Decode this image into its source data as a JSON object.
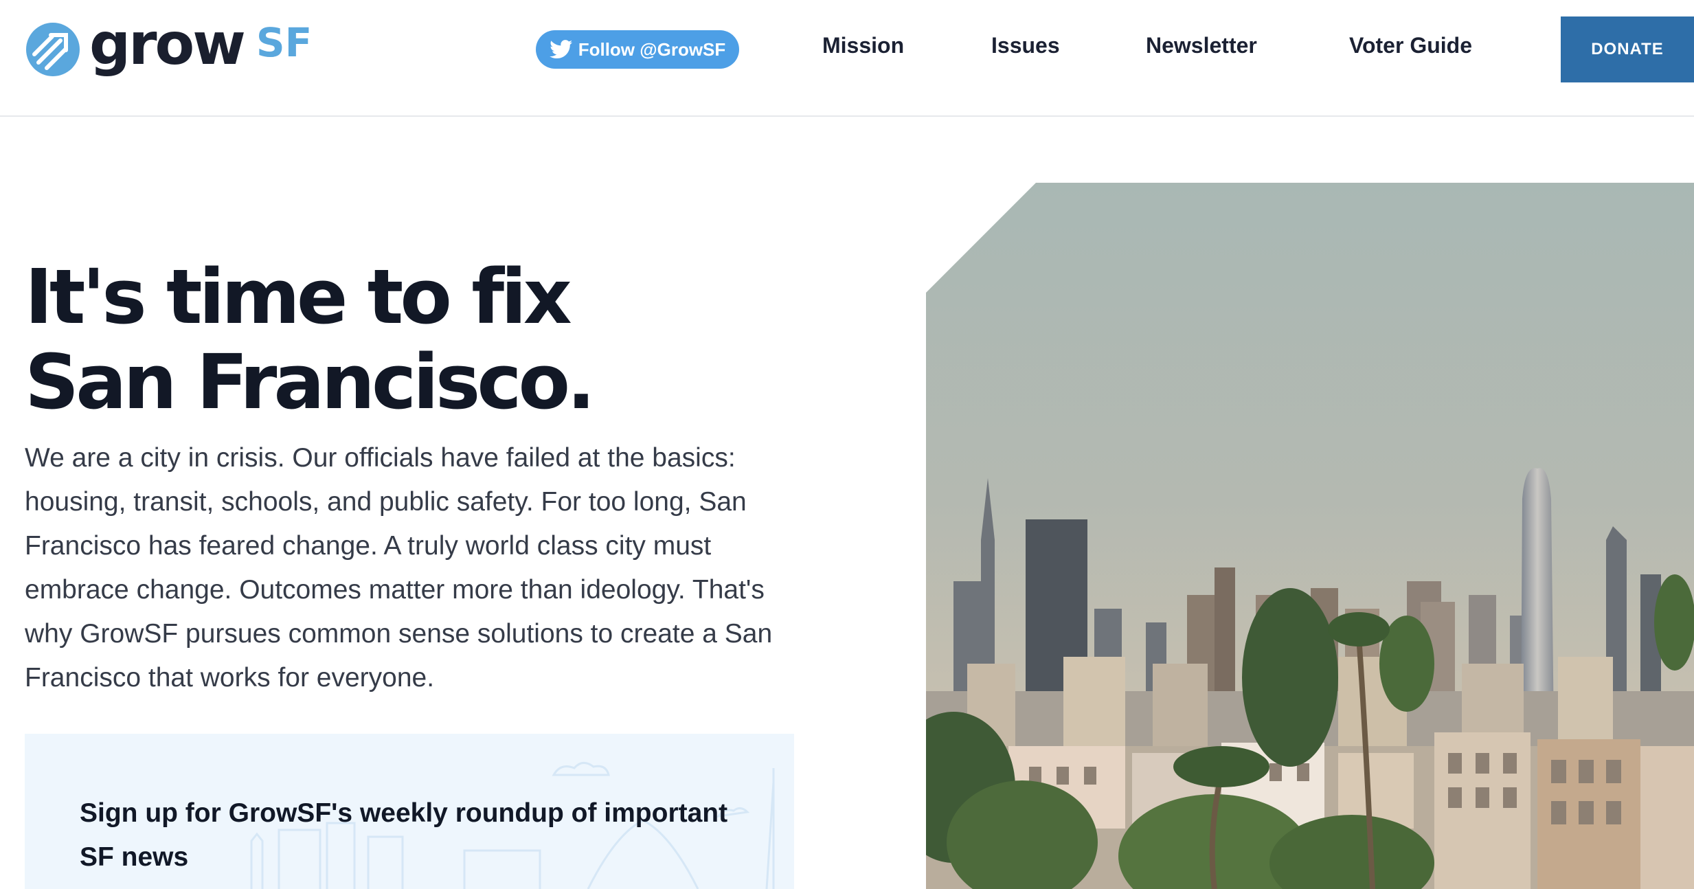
{
  "brand": {
    "logo_text": "grow",
    "logo_suffix": "SF",
    "logo_icon": "arrows-circle-icon",
    "accent_color": "#5aa7dd",
    "dark_color": "#1a1f2e"
  },
  "header": {
    "twitter_label": "Follow @GrowSF",
    "twitter_icon": "twitter-bird-icon",
    "nav": {
      "mission": "Mission",
      "issues": "Issues",
      "newsletter": "Newsletter",
      "voter_guide": "Voter Guide"
    },
    "donate_label": "DONATE",
    "donate_color": "#2e6ea8",
    "twitter_color": "#4d9fe6"
  },
  "hero": {
    "headline_line1": "It's time to fix",
    "headline_line2": "San Francisco.",
    "intro": "We are a city in crisis. Our officials have failed at the basics: housing, transit, schools, and public safety. For too long, San Francisco has feared change. A truly world class city must embrace change. Outcomes matter more than ideology. That's why GrowSF pursues common sense solutions to create a San Francisco that works for everyone."
  },
  "signup": {
    "title": "Sign up for GrowSF's weekly roundup of important SF news",
    "background_color": "#eef6fd"
  }
}
